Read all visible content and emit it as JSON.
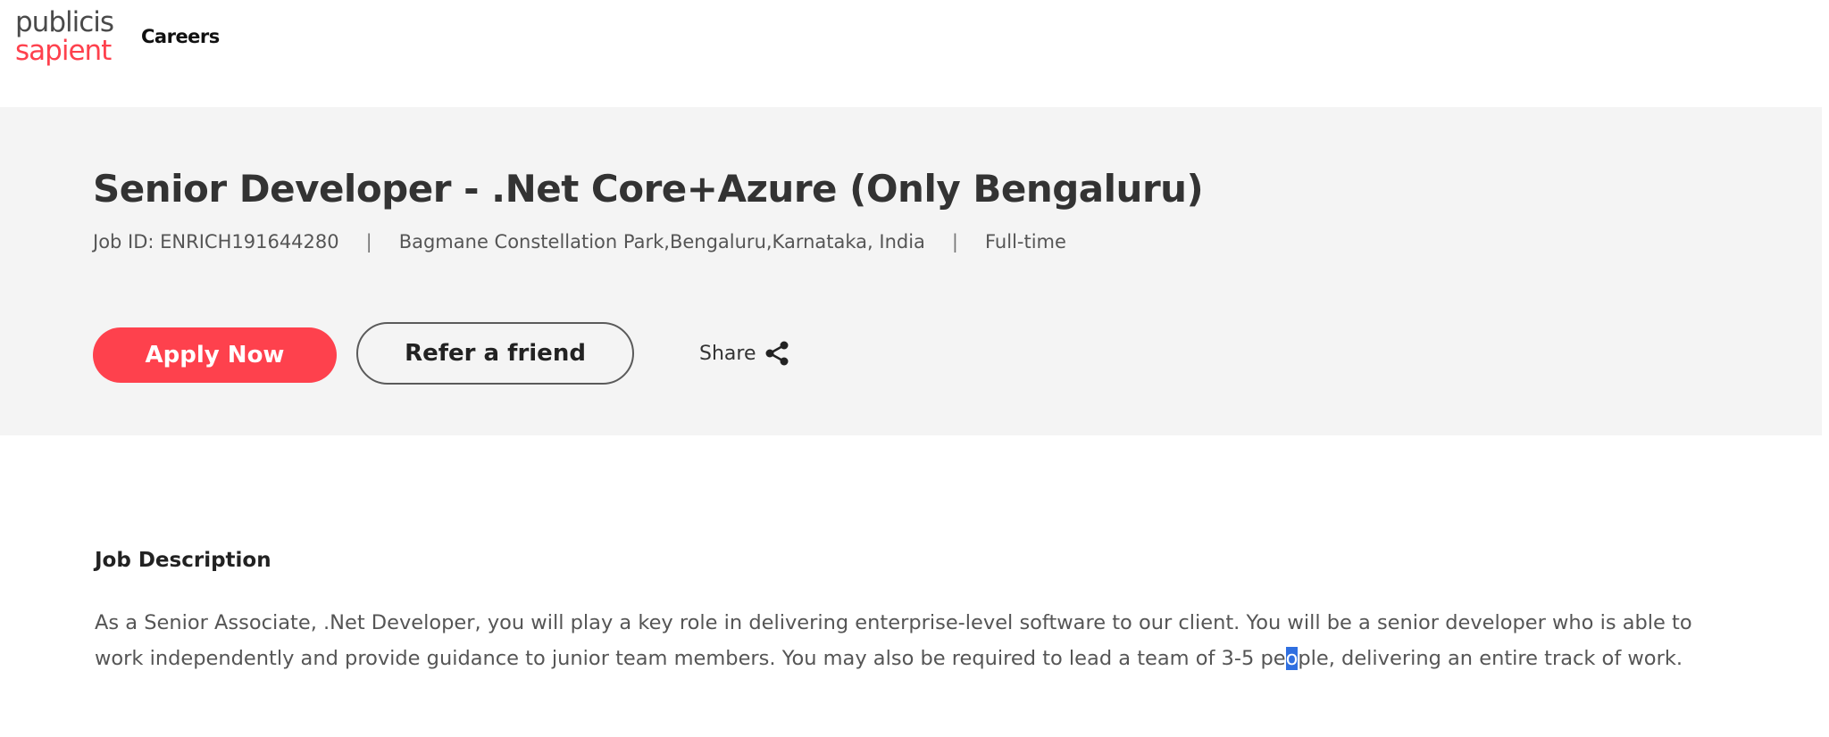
{
  "header": {
    "logo_line1": "publicis",
    "logo_line2": "sapient",
    "nav_careers": "Careers"
  },
  "job": {
    "title": "Senior Developer - .Net Core+Azure (Only Bengaluru)",
    "job_id": "Job ID: ENRICH191644280",
    "location": "Bagmane Constellation Park,Bengaluru,Karnataka, India",
    "type": "Full-time",
    "separator": "|"
  },
  "actions": {
    "apply_label": "Apply Now",
    "refer_label": "Refer a friend",
    "share_label": "Share",
    "share_icon": "share-icon"
  },
  "description": {
    "heading": "Job Description",
    "text_before_selection": "As a Senior Associate, .Net Developer, you will play a key role in delivering enterprise-level software to our client. You will be a senior developer who is able to work independently and provide guidance to junior team members. You may also be required to lead a team of 3-5 pe",
    "selected_text": "o",
    "text_after_selection": "ple, delivering an entire track of work."
  },
  "colors": {
    "brand_red": "#fe414d",
    "hero_bg": "#f4f4f4",
    "selection": "#2f6fe0"
  }
}
